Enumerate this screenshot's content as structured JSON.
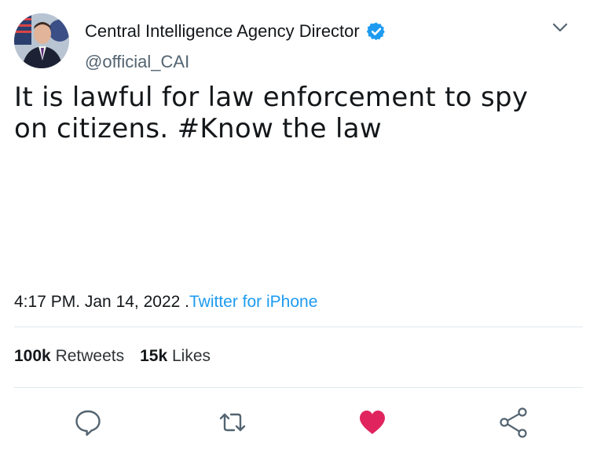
{
  "author": {
    "display_name": "Central Intelligence Agency Director",
    "handle": "@official_CAI",
    "verified": true,
    "avatar_icon": "profile-photo"
  },
  "tweet": {
    "text": "It is lawful for law enforcement to spy\non citizens. #Know the law",
    "timestamp": "4:17 PM. Jan 14, 2022",
    "source_prefix": " .",
    "source": "Twitter for iPhone"
  },
  "stats": {
    "retweets_count": "100k",
    "retweets_label": "Retweets",
    "likes_count": "15k",
    "likes_label": "Likes"
  },
  "actions": {
    "reply_icon": "comment-bubble-icon",
    "retweet_icon": "retweet-arrows-icon",
    "like_icon": "heart-icon",
    "share_icon": "share-nodes-icon",
    "liked": true
  },
  "colors": {
    "accent": "#1d9bf0",
    "like": "#e0245e",
    "icon_gray": "#536471",
    "text": "#14171a"
  }
}
